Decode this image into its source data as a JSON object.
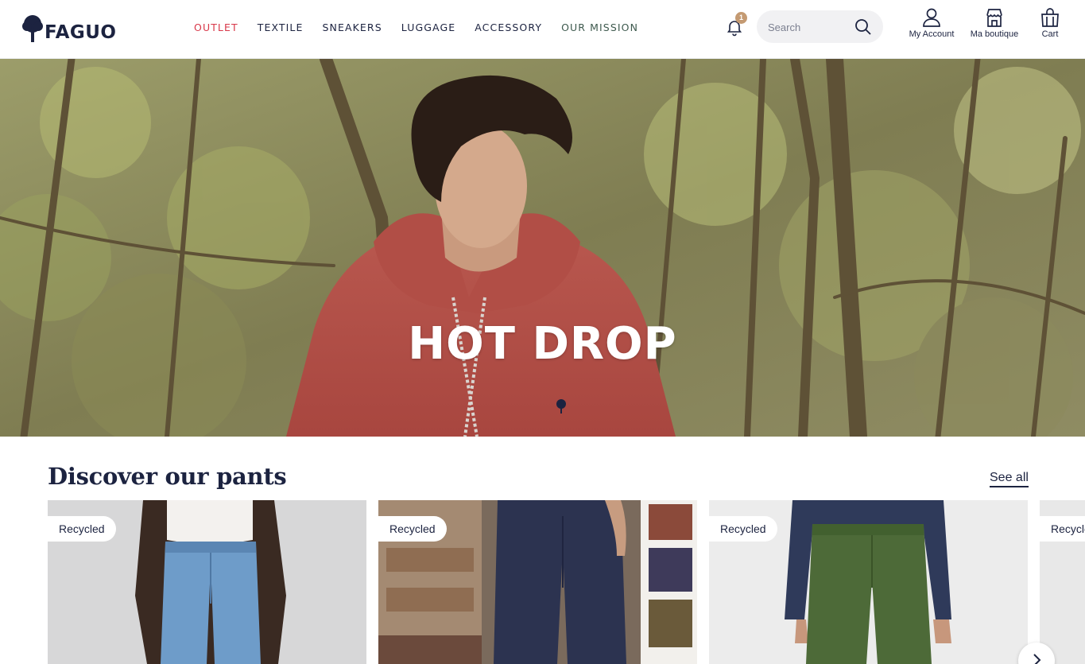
{
  "brand": {
    "name": "FAGUO"
  },
  "nav": {
    "items": [
      {
        "label": "OUTLET"
      },
      {
        "label": "TEXTILE"
      },
      {
        "label": "SNEAKERS"
      },
      {
        "label": "LUGGAGE"
      },
      {
        "label": "ACCESSORY"
      },
      {
        "label": "OUR MISSION"
      }
    ]
  },
  "notifications": {
    "count": "1"
  },
  "search": {
    "placeholder": "Search",
    "value": ""
  },
  "header_actions": {
    "account_label": "My Account",
    "shop_label": "Ma boutique",
    "cart_label": "Cart"
  },
  "hero": {
    "title": "HOT DROP"
  },
  "section": {
    "title": "Discover our pants",
    "see_all_label": "See all"
  },
  "products": [
    {
      "badge": "Recycled",
      "image": "light blue jeans"
    },
    {
      "badge": "Recycled",
      "image": "raw denim jeans"
    },
    {
      "badge": "Recycled",
      "image": "green chino pants"
    },
    {
      "badge": "Recycle",
      "image": "partially visible product"
    }
  ],
  "colors": {
    "brand_navy": "#1c2340",
    "outlet_red": "#d8394a",
    "mission_green": "#3e5a4e",
    "badge_bg": "#c49a72"
  }
}
